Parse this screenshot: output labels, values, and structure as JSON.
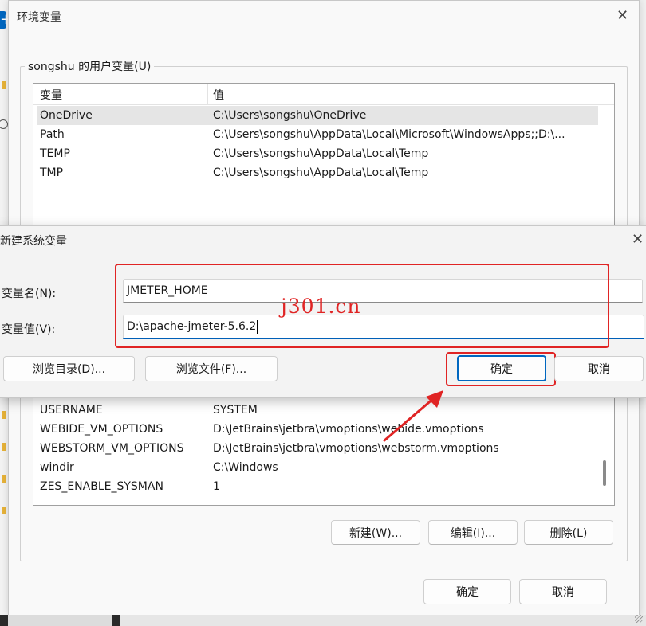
{
  "env_window": {
    "title": "环境变量",
    "user_group_label": "songshu 的用户变量(U)",
    "columns": {
      "name": "变量",
      "value": "值"
    },
    "user_vars": [
      {
        "name": "OneDrive",
        "value": "C:\\Users\\songshu\\OneDrive"
      },
      {
        "name": "Path",
        "value": "C:\\Users\\songshu\\AppData\\Local\\Microsoft\\WindowsApps;;D:\\..."
      },
      {
        "name": "TEMP",
        "value": "C:\\Users\\songshu\\AppData\\Local\\Temp"
      },
      {
        "name": "TMP",
        "value": "C:\\Users\\songshu\\AppData\\Local\\Temp"
      }
    ],
    "system_vars": [
      {
        "name": "USERNAME",
        "value": "SYSTEM"
      },
      {
        "name": "WEBIDE_VM_OPTIONS",
        "value": "D:\\JetBrains\\jetbra\\vmoptions\\webide.vmoptions"
      },
      {
        "name": "WEBSTORM_VM_OPTIONS",
        "value": "D:\\JetBrains\\jetbra\\vmoptions\\webstorm.vmoptions"
      },
      {
        "name": "windir",
        "value": "C:\\Windows"
      },
      {
        "name": "ZES_ENABLE_SYSMAN",
        "value": "1"
      }
    ],
    "system_buttons": {
      "new": "新建(W)...",
      "edit": "编辑(I)...",
      "delete": "删除(L)"
    },
    "ok": "确定",
    "cancel": "取消"
  },
  "new_dialog": {
    "title": "新建系统变量",
    "name_label": "变量名(N):",
    "value_label": "变量值(V):",
    "name_value": "JMETER_HOME",
    "value_value": "D:\\apache-jmeter-5.6.2",
    "browse_dir": "浏览目录(D)...",
    "browse_file": "浏览文件(F)...",
    "ok": "确定",
    "cancel": "取消"
  },
  "watermark": "j301.cn",
  "colors": {
    "accent": "#0067c0",
    "annotation_red": "#e02424"
  }
}
